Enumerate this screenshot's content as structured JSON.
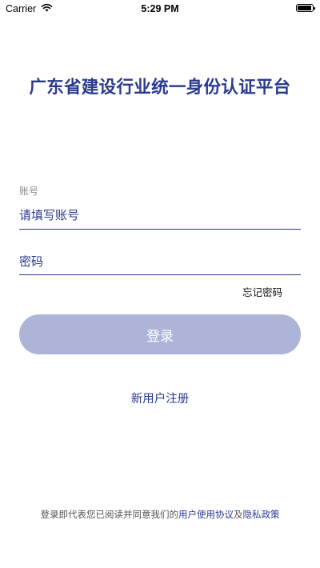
{
  "status_bar": {
    "carrier": "Carrier",
    "time": "5:29 PM",
    "battery_level": 0.95
  },
  "title": "广东省建设行业统一身份认证平台",
  "account": {
    "label": "账号",
    "placeholder": "请填写账号"
  },
  "password": {
    "placeholder": "密码"
  },
  "forgot_password": "忘记密码",
  "login_button": "登录",
  "register_link": "新用户注册",
  "agreement": {
    "prefix": "登录即代表您已阅读并同意我们的",
    "user_agreement": "用户使用协议",
    "and": "及",
    "privacy_policy": "隐私政策"
  },
  "colors": {
    "brand": "#2a3a8f",
    "button_disabled": "#aeb4d8",
    "underline": "#2a3a8f",
    "link": "#2a3a8f"
  }
}
